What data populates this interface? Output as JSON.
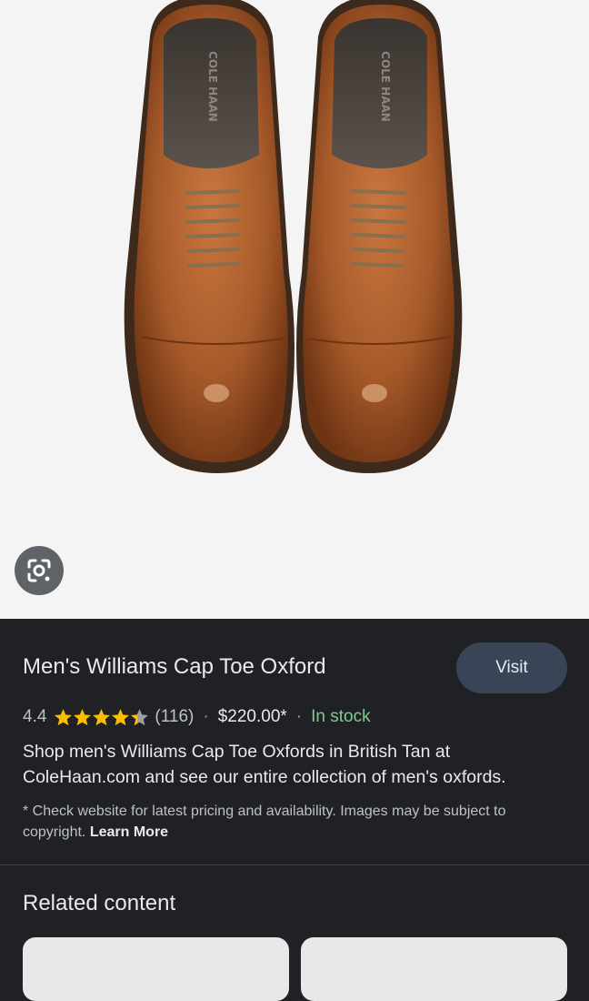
{
  "product": {
    "title": "Men's Williams Cap Toe Oxford",
    "rating": "4.4",
    "stars": 4.4,
    "reviews": "(116)",
    "price": "$220.00*",
    "stock": "In stock",
    "description": "Shop men's Williams Cap Toe Oxfords in British Tan at ColeHaan.com and see our entire collection of men's oxfords.",
    "note": "* Check website for latest pricing and availability. Images may be subject to copyright.",
    "learn_more": "Learn More",
    "visit_label": "Visit"
  },
  "image": {
    "insole_brand": "COLE HAAN"
  },
  "related": {
    "title": "Related content"
  },
  "colors": {
    "stock": "#81c995",
    "star": "#fbbc04",
    "visit_bg": "#394457"
  }
}
